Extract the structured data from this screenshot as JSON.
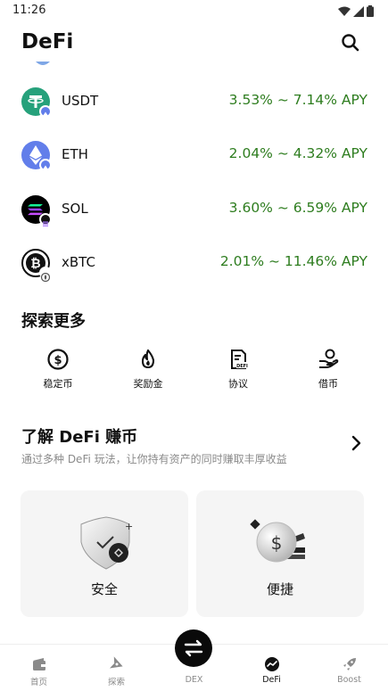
{
  "status_bar": {
    "time": "11:26"
  },
  "header": {
    "title": "DeFi"
  },
  "assets": [
    {
      "symbol": "USDT",
      "apy": "3.53% ~ 7.14% APY",
      "color": "#26a17b",
      "badge_color": "#627eea"
    },
    {
      "symbol": "ETH",
      "apy": "2.04% ~ 4.32% APY",
      "color": "#627eea",
      "badge_color": "#627eea"
    },
    {
      "symbol": "SOL",
      "apy": "3.60% ~ 6.59% APY",
      "color": "#000000",
      "badge_color": "#111111"
    },
    {
      "symbol": "xBTC",
      "apy": "2.01% ~ 11.46% APY",
      "color": "#111111",
      "badge_color": "#555555"
    }
  ],
  "explore": {
    "title": "探索更多",
    "items": [
      {
        "label": "稳定币",
        "icon": "dollar-circle-icon"
      },
      {
        "label": "奖励金",
        "icon": "flame-icon"
      },
      {
        "label": "协议",
        "icon": "document-defi-icon"
      },
      {
        "label": "借币",
        "icon": "hand-coin-icon"
      }
    ]
  },
  "learn": {
    "title": "了解 DeFi 赚币",
    "subtitle": "通过多种 DeFi 玩法，让你持有资产的同时赚取丰厚收益",
    "cards": [
      {
        "label": "安全",
        "icon": "shield-check-icon"
      },
      {
        "label": "便捷",
        "icon": "dollar-coin-icon"
      }
    ]
  },
  "bottom_nav": {
    "items": [
      {
        "label": "首页",
        "icon": "wallet-icon",
        "active": false
      },
      {
        "label": "探索",
        "icon": "compass-icon",
        "active": false
      },
      {
        "label": "DEX",
        "icon": "swap-icon",
        "active": false
      },
      {
        "label": "DeFi",
        "icon": "defi-chart-icon",
        "active": true
      },
      {
        "label": "Boost",
        "icon": "rocket-icon",
        "active": false
      }
    ]
  },
  "colors": {
    "apy_green": "#2e7d1f",
    "text": "#111111",
    "muted": "#8a8a8a",
    "card_bg": "#f5f5f5"
  }
}
